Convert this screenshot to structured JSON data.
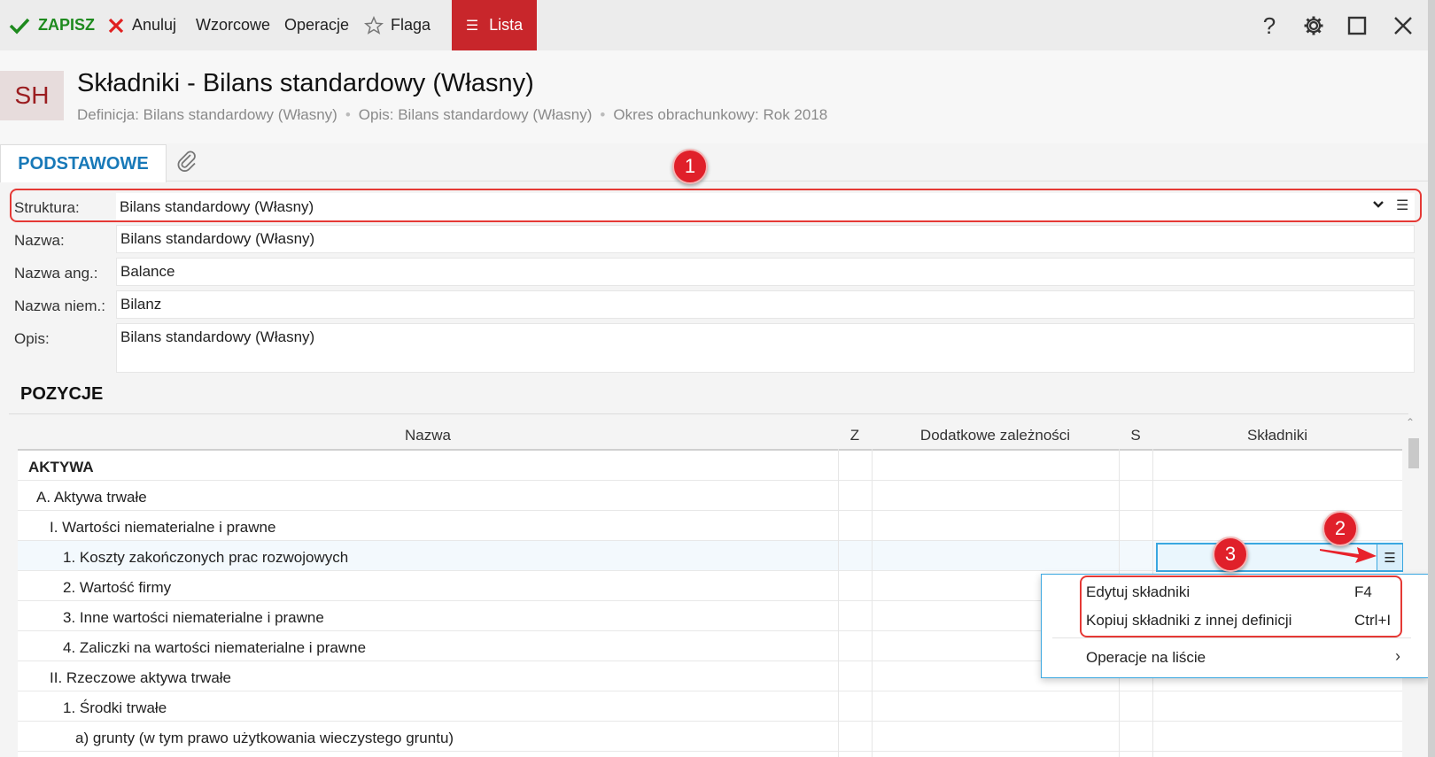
{
  "toolbar": {
    "save": "ZAPISZ",
    "cancel": "Anuluj",
    "templates": "Wzorcowe",
    "operations": "Operacje",
    "flag": "Flaga",
    "list": "Lista",
    "help": "?"
  },
  "header": {
    "badge": "SH",
    "title": "Składniki - Bilans standardowy (Własny)",
    "subtitle": {
      "definition": "Definicja: Bilans standardowy (Własny)",
      "description": "Opis: Bilans standardowy (Własny)",
      "period": "Okres obrachunkowy: Rok 2018"
    }
  },
  "tabs": {
    "main": "PODSTAWOWE"
  },
  "form": {
    "structure_label": "Struktura:",
    "structure_value": "Bilans standardowy (Własny)",
    "name_label": "Nazwa:",
    "name_value": "Bilans standardowy (Własny)",
    "name_en_label": "Nazwa ang.:",
    "name_en_value": "Balance",
    "name_de_label": "Nazwa niem.:",
    "name_de_value": "Bilanz",
    "desc_label": "Opis:",
    "desc_value": "Bilans standardowy (Własny)"
  },
  "positions": {
    "title": "POZYCJE",
    "columns": {
      "name": "Nazwa",
      "z": "Z",
      "extra": "Dodatkowe zależności",
      "s": "S",
      "components": "Składniki"
    },
    "rows": [
      "AKTYWA",
      "A. Aktywa trwałe",
      "I. Wartości niematerialne i prawne",
      "1. Koszty zakończonych prac rozwojowych",
      "2. Wartość firmy",
      "3. Inne wartości niematerialne i prawne",
      "4. Zaliczki na wartości niematerialne i prawne",
      "II. Rzeczowe aktywa trwałe",
      "1. Środki trwałe",
      "a) grunty (w tym prawo użytkowania wieczystego gruntu)"
    ]
  },
  "context_menu": {
    "edit": "Edytuj składniki",
    "edit_shortcut": "F4",
    "copy": "Kopiuj składniki z innej definicji",
    "copy_shortcut": "Ctrl+I",
    "list_ops": "Operacje na liście"
  },
  "annotations": {
    "one": "1",
    "two": "2",
    "three": "3"
  }
}
